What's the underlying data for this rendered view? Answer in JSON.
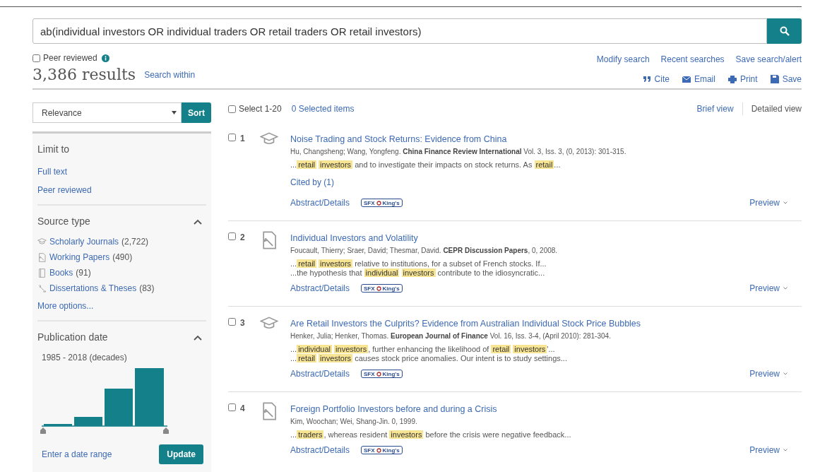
{
  "search": {
    "value": "ab(individual investors OR individual traders OR retail traders OR retail investors)"
  },
  "peer_reviewed": {
    "label": "Peer reviewed",
    "checked": false
  },
  "result_count": "3,386 results",
  "search_within": "Search within",
  "top_links": [
    "Modify search",
    "Recent searches",
    "Save search/alert"
  ],
  "actions": [
    {
      "kind": "cite",
      "label": "Cite"
    },
    {
      "kind": "email",
      "label": "Email"
    },
    {
      "kind": "print",
      "label": "Print"
    },
    {
      "kind": "save",
      "label": "Save"
    }
  ],
  "sort": {
    "value": "Relevance",
    "button": "Sort"
  },
  "select_all": {
    "label": "Select 1-20",
    "checked": false
  },
  "selected_items": "0 Selected items",
  "views": [
    {
      "label": "Brief view",
      "selected": false
    },
    {
      "label": "Detailed view",
      "selected": true
    }
  ],
  "sidebar": {
    "limit_title": "Limit to",
    "limit_links": [
      "Full text",
      "Peer reviewed"
    ],
    "source_title": "Source type",
    "source_expanded": true,
    "sources": [
      {
        "kind": "journal",
        "label": "Scholarly Journals",
        "count": "(2,722)"
      },
      {
        "kind": "paper",
        "label": "Working Papers",
        "count": "(490)"
      },
      {
        "kind": "book",
        "label": "Books",
        "count": "(91)"
      },
      {
        "kind": "dissertation",
        "label": "Dissertations & Theses",
        "count": "(83)"
      }
    ],
    "more_options": "More options...",
    "date_title": "Publication date",
    "date_expanded": true,
    "date_range": "1985 - 2018 (decades)",
    "enter_range": "Enter a date range",
    "update": "Update"
  },
  "results": [
    {
      "number": "1",
      "kind": "journal",
      "checked": false,
      "title": "Noise Trading and Stock Returns: Evidence from China",
      "citation": "Hu, Changsheng; Wang, Yongfeng. **China Finance Review International** Vol. 3, Iss. 3,  (0, 2013): 301-315.",
      "snippets": [
        [
          {
            "text": "...",
            "highlight": false
          },
          {
            "text": "retail",
            "highlight": true
          },
          {
            "text": "investors",
            "highlight": true
          },
          {
            "text": " and to investigate their impacts on stock returns. As ",
            "highlight": false
          },
          {
            "text": "retail",
            "highlight": true
          },
          {
            "text": "...",
            "highlight": false
          }
        ]
      ],
      "cited_by": "Cited by (1)",
      "abstract": "Abstract/Details",
      "badge": [
        "SFX",
        "King's"
      ],
      "preview": "Preview"
    },
    {
      "number": "2",
      "kind": "paper",
      "checked": false,
      "title": "Individual Investors and Volatility",
      "citation": "Foucault, Thierry; Sraer, David; Thesmar, David. **CEPR Discussion Papers**, 0, 2008.",
      "snippets": [
        [
          {
            "text": "...",
            "highlight": false
          },
          {
            "text": "retail",
            "highlight": true
          },
          {
            "text": "investors",
            "highlight": true
          },
          {
            "text": " relative to institutions, for a subset of French stocks. If...",
            "highlight": false
          }
        ],
        [
          {
            "text": "...the hypothesis that ",
            "highlight": false
          },
          {
            "text": "individual",
            "highlight": true
          },
          {
            "text": "investors",
            "highlight": true
          },
          {
            "text": " contribute to the idiosyncratic...",
            "highlight": false
          }
        ]
      ],
      "abstract": "Abstract/Details",
      "badge": [
        "SFX",
        "King's"
      ],
      "preview": "Preview"
    },
    {
      "number": "3",
      "kind": "journal",
      "checked": false,
      "title": "Are Retail Investors the Culprits? Evidence from Australian Individual Stock Price Bubbles",
      "citation": "Henker, Julia; Henker, Thomas. **European Journal of Finance** Vol. 16, Iss. 3-4,  (April 2010): 281-304.",
      "snippets": [
        [
          {
            "text": "...",
            "highlight": false
          },
          {
            "text": "individual",
            "highlight": true
          },
          {
            "text": "investors",
            "highlight": true
          },
          {
            "text": ", further enhancing the likelihood of ",
            "highlight": false
          },
          {
            "text": "retail",
            "highlight": true
          },
          {
            "text": "investors",
            "highlight": true
          },
          {
            "text": "'...",
            "highlight": false
          }
        ],
        [
          {
            "text": "...",
            "highlight": false
          },
          {
            "text": "retail",
            "highlight": true
          },
          {
            "text": "investors",
            "highlight": true
          },
          {
            "text": " causes stock price anomalies. Our intent is to study settings...",
            "highlight": false
          }
        ]
      ],
      "abstract": "Abstract/Details",
      "badge": [
        "SFX",
        "King's"
      ],
      "preview": "Preview"
    },
    {
      "number": "4",
      "kind": "paper",
      "checked": false,
      "title": "Foreign Portfolio Investors before and during a Crisis",
      "citation": "Kim, Woochan; Wei, Shang-Jin. 0, 1999.",
      "snippets": [
        [
          {
            "text": "...",
            "highlight": false
          },
          {
            "text": "traders",
            "highlight": true
          },
          {
            "text": ", whereas resident ",
            "highlight": false
          },
          {
            "text": "investors",
            "highlight": true
          },
          {
            "text": " before the crisis were negative feedback...",
            "highlight": false
          }
        ]
      ],
      "abstract": "Abstract/Details",
      "badge": [
        "SFX",
        "King's"
      ],
      "preview": "Preview"
    }
  ]
}
